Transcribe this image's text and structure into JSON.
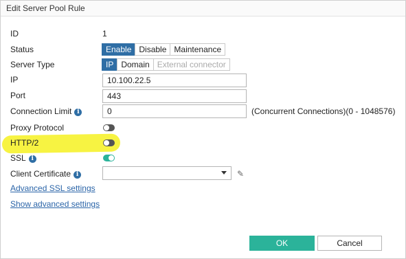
{
  "dialog": {
    "title": "Edit Server Pool Rule"
  },
  "fields": {
    "id": {
      "label": "ID",
      "value": "1"
    },
    "status": {
      "label": "Status",
      "options": [
        "Enable",
        "Disable",
        "Maintenance"
      ],
      "selected": "Enable"
    },
    "server_type": {
      "label": "Server Type",
      "options": [
        "IP",
        "Domain",
        "External connector"
      ],
      "selected": "IP",
      "disabled_option": "External connector"
    },
    "ip": {
      "label": "IP",
      "value": "10.100.22.5"
    },
    "port": {
      "label": "Port",
      "value": "443"
    },
    "connection_limit": {
      "label": "Connection Limit",
      "value": "0",
      "hint": "(Concurrent Connections)(0 - 1048576)",
      "info_icon": "info-icon"
    },
    "proxy_protocol": {
      "label": "Proxy Protocol",
      "enabled": false
    },
    "http2": {
      "label": "HTTP/2",
      "enabled": false
    },
    "ssl": {
      "label": "SSL",
      "enabled": true,
      "info_icon": "info-icon"
    },
    "client_certificate": {
      "label": "Client Certificate",
      "value": "",
      "info_icon": "info-icon",
      "edit_icon": "pencil-icon"
    }
  },
  "links": {
    "advanced_ssl": "Advanced SSL settings",
    "advanced": "Show advanced settings"
  },
  "buttons": {
    "ok": "OK",
    "cancel": "Cancel"
  },
  "colors": {
    "accent": "#2f6ea5",
    "toggle_on": "#2bb39a",
    "ok_button": "#2bb39a",
    "highlight": "#f7f238"
  }
}
